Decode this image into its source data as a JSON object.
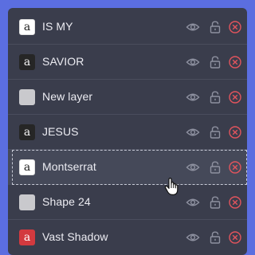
{
  "layers": [
    {
      "name": "IS MY",
      "thumb_type": "white",
      "thumb_glyph": "a",
      "state": "normal"
    },
    {
      "name": "SAVIOR",
      "thumb_type": "dark",
      "thumb_glyph": "a",
      "state": "normal"
    },
    {
      "name": "New layer",
      "thumb_type": "gray",
      "thumb_glyph": "",
      "state": "normal"
    },
    {
      "name": "JESUS",
      "thumb_type": "dark",
      "thumb_glyph": "a",
      "state": "normal"
    },
    {
      "name": "Montserrat",
      "thumb_type": "white",
      "thumb_glyph": "a",
      "state": "hovered"
    },
    {
      "name": "Shape 24",
      "thumb_type": "gray",
      "thumb_glyph": "",
      "state": "normal"
    },
    {
      "name": "Vast Shadow",
      "thumb_type": "red",
      "thumb_glyph": "a",
      "state": "normal"
    }
  ],
  "icons": {
    "visibility": "eye-icon",
    "lock": "lock-icon",
    "delete": "delete-circle-x-icon",
    "cursor": "hand-pointer-cursor"
  },
  "colors": {
    "page_background": "#5b6ee0",
    "panel_background": "#3a3d4c",
    "icon_gray": "#8e91a0",
    "delete_red": "#e2545d"
  }
}
